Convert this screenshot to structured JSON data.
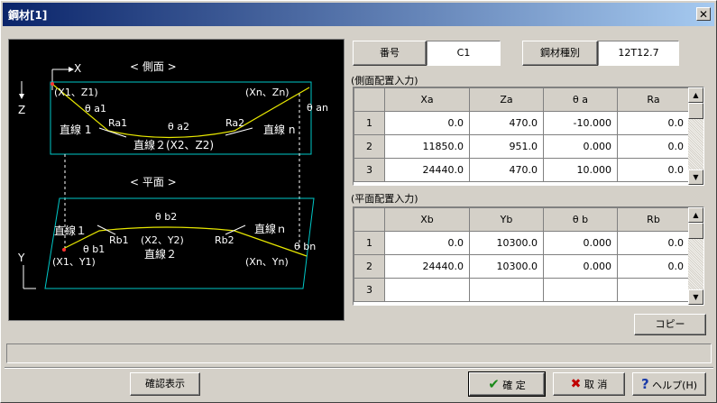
{
  "window": {
    "title": "鋼材[1]"
  },
  "diagram": {
    "side_title": "< 側面 >",
    "plan_title": "< 平面 >",
    "axis_x": "X",
    "axis_z": "Z",
    "axis_y": "Y",
    "side_labels": {
      "p1": "(X1、Z1)",
      "pn": "(Xn、Zn)",
      "theta_a1": "θ a1",
      "theta_an": "θ an",
      "ra1": "Ra1",
      "theta_a2": "θ a2",
      "ra2": "Ra2",
      "line1": "直線 1",
      "line2": "直線２(X2、Z2)",
      "linen": "直線 n"
    },
    "plan_labels": {
      "theta_b2": "θ b2",
      "line1": "直線１",
      "linen": "直線ｎ",
      "rb1": "Rb1",
      "theta_b1": "θ b1",
      "p2": "(X2、Y2)",
      "rb2": "Rb2",
      "theta_bn": "θ bn",
      "p1": "(X1、Y1)",
      "line2": "直線２",
      "pn": "(Xn、Yn)"
    },
    "colors": {
      "background": "#000000",
      "frame": "#00c8c8",
      "curve": "#e8e800",
      "text": "#ffffff",
      "guide": "#ffffff"
    }
  },
  "header": {
    "number_label": "番号",
    "number_value": "C1",
    "type_label": "鋼材種別",
    "type_value": "12T12.7"
  },
  "side_section": {
    "title": "(側面配置入力)",
    "columns": [
      "",
      "Xa",
      "Za",
      "θ a",
      "Ra"
    ],
    "rows": [
      {
        "no": "1",
        "cells": [
          "0.0",
          "470.0",
          "-10.000",
          "0.0"
        ]
      },
      {
        "no": "2",
        "cells": [
          "11850.0",
          "951.0",
          "0.000",
          "0.0"
        ]
      },
      {
        "no": "3",
        "cells": [
          "24440.0",
          "470.0",
          "10.000",
          "0.0"
        ]
      }
    ]
  },
  "plan_section": {
    "title": "(平面配置入力)",
    "columns": [
      "",
      "Xb",
      "Yb",
      "θ b",
      "Rb"
    ],
    "rows": [
      {
        "no": "1",
        "cells": [
          "0.0",
          "10300.0",
          "0.000",
          "0.0"
        ]
      },
      {
        "no": "2",
        "cells": [
          "24440.0",
          "10300.0",
          "0.000",
          "0.0"
        ]
      },
      {
        "no": "3",
        "cells": [
          "",
          "",
          "",
          ""
        ]
      }
    ]
  },
  "buttons": {
    "copy": "コピー",
    "confirm_view": "確認表示",
    "ok": "確 定",
    "cancel": "取 消",
    "help": "ヘルプ(H)"
  }
}
